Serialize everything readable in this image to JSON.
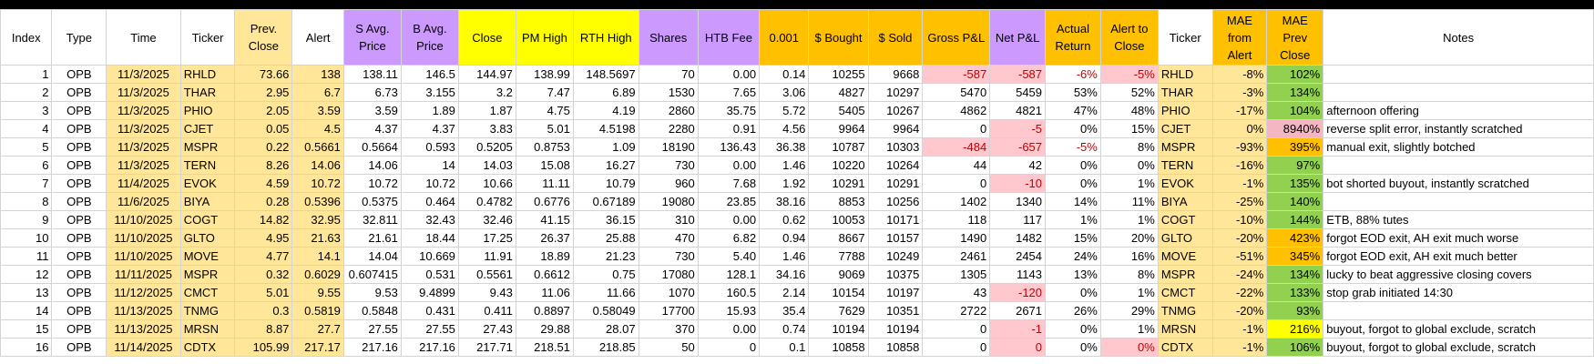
{
  "headers": [
    "Index",
    "Type",
    "Time",
    "Ticker",
    "Prev. Close",
    "Alert",
    "S Avg. Price",
    "B Avg. Price",
    "Close",
    "PM High",
    "RTH High",
    "Shares",
    "HTB Fee",
    "0.001",
    "$ Bought",
    "$ Sold",
    "Gross P&L",
    "Net P&L",
    "Actual Return",
    "Alert to Close",
    "Ticker",
    "MAE from Alert",
    "MAE Prev Close",
    "Notes"
  ],
  "rows": [
    [
      "1",
      "OPB",
      "11/3/2025",
      "RHLD",
      "73.66",
      "138",
      "138.11",
      "146.5",
      "144.97",
      "138.99",
      "148.5697",
      "70",
      "0.00",
      "0.14",
      "10255",
      "9668",
      "-587",
      "-587",
      "-6%",
      "-5%",
      "RHLD",
      "-8%",
      "102%",
      ""
    ],
    [
      "2",
      "OPB",
      "11/3/2025",
      "THAR",
      "2.95",
      "6.7",
      "6.73",
      "3.155",
      "3.2",
      "7.47",
      "6.89",
      "1530",
      "7.65",
      "3.06",
      "4827",
      "10297",
      "5470",
      "5459",
      "53%",
      "52%",
      "THAR",
      "-3%",
      "134%",
      ""
    ],
    [
      "3",
      "OPB",
      "11/3/2025",
      "PHIO",
      "2.05",
      "3.59",
      "3.59",
      "1.89",
      "1.87",
      "4.75",
      "4.19",
      "2860",
      "35.75",
      "5.72",
      "5405",
      "10267",
      "4862",
      "4821",
      "47%",
      "48%",
      "PHIO",
      "-17%",
      "104%",
      "afternoon offering"
    ],
    [
      "4",
      "OPB",
      "11/3/2025",
      "CJET",
      "0.05",
      "4.5",
      "4.37",
      "4.37",
      "3.83",
      "5.01",
      "4.5198",
      "2280",
      "0.91",
      "4.56",
      "9964",
      "9964",
      "0",
      "-5",
      "0%",
      "15%",
      "CJET",
      "0%",
      "8940%",
      "reverse split error, instantly scratched"
    ],
    [
      "5",
      "OPB",
      "11/3/2025",
      "MSPR",
      "0.22",
      "0.5661",
      "0.5664",
      "0.593",
      "0.5205",
      "0.8753",
      "1.09",
      "18190",
      "136.43",
      "36.38",
      "10787",
      "10303",
      "-484",
      "-657",
      "-5%",
      "8%",
      "MSPR",
      "-93%",
      "395%",
      "manual exit, slightly botched"
    ],
    [
      "6",
      "OPB",
      "11/3/2025",
      "TERN",
      "8.26",
      "14.06",
      "14.06",
      "14",
      "14.03",
      "15.08",
      "16.27",
      "730",
      "0.00",
      "1.46",
      "10220",
      "10264",
      "44",
      "42",
      "0%",
      "0%",
      "TERN",
      "-16%",
      "97%",
      ""
    ],
    [
      "7",
      "OPB",
      "11/4/2025",
      "EVOK",
      "4.59",
      "10.72",
      "10.72",
      "10.72",
      "10.66",
      "11.11",
      "10.79",
      "960",
      "7.68",
      "1.92",
      "10291",
      "10291",
      "0",
      "-10",
      "0%",
      "1%",
      "EVOK",
      "-1%",
      "135%",
      "bot shorted buyout, instantly scratched"
    ],
    [
      "8",
      "OPB",
      "11/6/2025",
      "BIYA",
      "0.28",
      "0.5396",
      "0.5375",
      "0.464",
      "0.4782",
      "0.6776",
      "0.67189",
      "19080",
      "23.85",
      "38.16",
      "8853",
      "10256",
      "1402",
      "1340",
      "14%",
      "11%",
      "BIYA",
      "-25%",
      "140%",
      ""
    ],
    [
      "9",
      "OPB",
      "11/10/2025",
      "COGT",
      "14.82",
      "32.95",
      "32.811",
      "32.43",
      "32.46",
      "41.15",
      "36.15",
      "310",
      "0.00",
      "0.62",
      "10053",
      "10171",
      "118",
      "117",
      "1%",
      "1%",
      "COGT",
      "-10%",
      "144%",
      "ETB, 88% tutes"
    ],
    [
      "10",
      "OPB",
      "11/10/2025",
      "GLTO",
      "4.95",
      "21.63",
      "21.61",
      "18.44",
      "17.25",
      "26.37",
      "25.88",
      "470",
      "6.82",
      "0.94",
      "8667",
      "10157",
      "1490",
      "1482",
      "15%",
      "20%",
      "GLTO",
      "-20%",
      "423%",
      "forgot EOD exit, AH exit much worse"
    ],
    [
      "11",
      "OPB",
      "11/10/2025",
      "MOVE",
      "4.77",
      "14.1",
      "14.04",
      "10.669",
      "11.91",
      "18.89",
      "21.23",
      "730",
      "5.40",
      "1.46",
      "7788",
      "10249",
      "2461",
      "2454",
      "24%",
      "16%",
      "MOVE",
      "-51%",
      "345%",
      "forgot EOD exit, AH exit much better"
    ],
    [
      "12",
      "OPB",
      "11/11/2025",
      "MSPR",
      "0.32",
      "0.6029",
      "0.607415",
      "0.531",
      "0.5561",
      "0.6612",
      "0.75",
      "17080",
      "128.1",
      "34.16",
      "9069",
      "10375",
      "1305",
      "1143",
      "13%",
      "8%",
      "MSPR",
      "-24%",
      "134%",
      "lucky to beat aggressive closing covers"
    ],
    [
      "13",
      "OPB",
      "11/12/2025",
      "CMCT",
      "5.01",
      "9.55",
      "9.53",
      "9.4899",
      "9.43",
      "11.06",
      "11.66",
      "1070",
      "160.5",
      "2.14",
      "10154",
      "10197",
      "43",
      "-120",
      "0%",
      "1%",
      "CMCT",
      "-22%",
      "133%",
      "stop grab initiated 14:30"
    ],
    [
      "14",
      "OPB",
      "11/13/2025",
      "TNMG",
      "0.3",
      "0.5819",
      "0.5848",
      "0.431",
      "0.411",
      "0.8897",
      "0.58049",
      "17700",
      "15.93",
      "35.4",
      "7629",
      "10351",
      "2722",
      "2671",
      "26%",
      "29%",
      "TNMG",
      "-20%",
      "93%",
      ""
    ],
    [
      "15",
      "OPB",
      "11/13/2025",
      "MRSN",
      "8.87",
      "27.7",
      "27.55",
      "27.55",
      "27.43",
      "29.88",
      "28.07",
      "370",
      "0.00",
      "0.74",
      "10194",
      "10194",
      "0",
      "-1",
      "0%",
      "1%",
      "MRSN",
      "-1%",
      "216%",
      "buyout, forgot to global exclude, scratch"
    ],
    [
      "16",
      "OPB",
      "11/14/2025",
      "CDTX",
      "105.99",
      "217.17",
      "217.16",
      "217.16",
      "217.71",
      "218.51",
      "218.85",
      "50",
      "0",
      "0.1",
      "10858",
      "10858",
      "0",
      "0",
      "0%",
      "0%",
      "CDTX",
      "-1%",
      "106%",
      "buyout, forgot to global exclude, scratch"
    ]
  ],
  "header_fills": [
    "",
    "",
    "",
    "",
    "#ffe699",
    "",
    "#cc99ff",
    "#cc99ff",
    "#ffff00",
    "#ffff00",
    "#ffff00",
    "#cc99ff",
    "#cc99ff",
    "#ffc000",
    "#ffc000",
    "#ffc000",
    "#ffc000",
    "#cc99ff",
    "#ffc000",
    "#ffc000",
    "",
    "#ffc000",
    "#ffc000",
    ""
  ],
  "cell_styles": {
    "0": {
      "16": "red bg-pink",
      "17": "red bg-pink",
      "18": "red",
      "19": "red bg-pink"
    },
    "3": {
      "17": "red bg-pink"
    },
    "4": {
      "16": "red bg-pink",
      "17": "red bg-pink",
      "18": "red"
    },
    "6": {
      "17": "red bg-pink"
    },
    "12": {
      "17": "red bg-pink"
    },
    "14": {
      "17": "red bg-pink"
    },
    "15": {
      "17": "red bg-pink",
      "19": "red bg-pink"
    }
  },
  "mae_colors": [
    "#92d050",
    "#92d050",
    "#92d050",
    "#f4b6c2",
    "#ffc000",
    "#92d050",
    "#92d050",
    "#92d050",
    "#92d050",
    "#ffc000",
    "#ffc000",
    "#92d050",
    "#92d050",
    "#92d050",
    "#ffff00",
    "#92d050"
  ]
}
